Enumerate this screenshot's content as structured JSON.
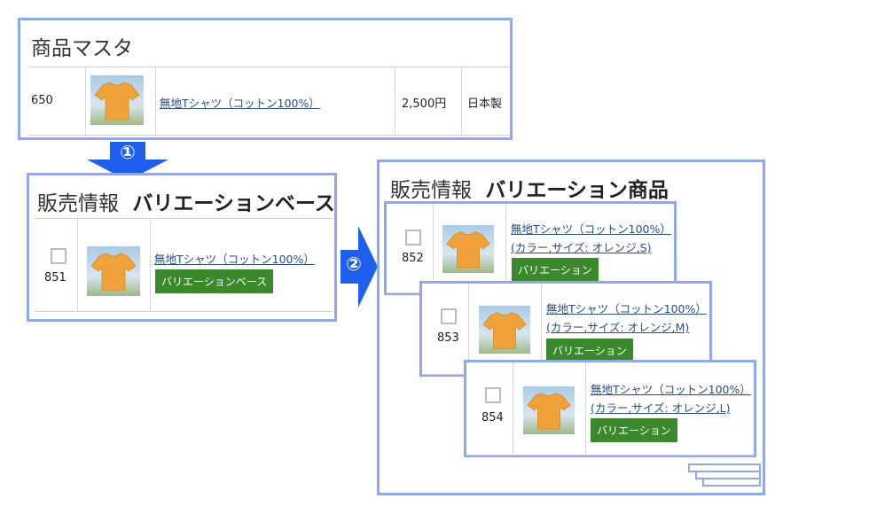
{
  "master": {
    "title": "商品マスタ",
    "row": {
      "id": "650",
      "name": "無地Tシャツ（コットン100%）",
      "price": "2,500円",
      "origin": "日本製"
    }
  },
  "base": {
    "title_prefix": "販売情報",
    "title_bold": "バリエーションベース",
    "row": {
      "id": "851",
      "name": "無地Tシャツ（コットン100%）",
      "badge": "バリエーションベース"
    }
  },
  "variation": {
    "title_prefix": "販売情報",
    "title_bold": "バリエーション商品",
    "items": [
      {
        "id": "852",
        "name": "無地Tシャツ（コットン100%）",
        "detail": "(カラー,サイズ: オレンジ,S)",
        "badge": "バリエーション"
      },
      {
        "id": "853",
        "name": "無地Tシャツ（コットン100%）",
        "detail": "(カラー,サイズ: オレンジ,M)",
        "badge": "バリエーション"
      },
      {
        "id": "854",
        "name": "無地Tシャツ（コットン100%）",
        "detail": "(カラー,サイズ: オレンジ,L)",
        "badge": "バリエーション"
      }
    ]
  },
  "steps": {
    "one": "①",
    "two": "②"
  },
  "icons": {
    "product_image": "orange-tshirt-icon",
    "checkbox": "checkbox-icon",
    "step_arrow": "arrow-icon"
  },
  "colors": {
    "panel_border": "#8fa8f5",
    "arrow_blue": "#1e5ff0",
    "badge_green": "#3a8a2c",
    "link": "#2a4e86",
    "shirt": "#f0a23a"
  }
}
